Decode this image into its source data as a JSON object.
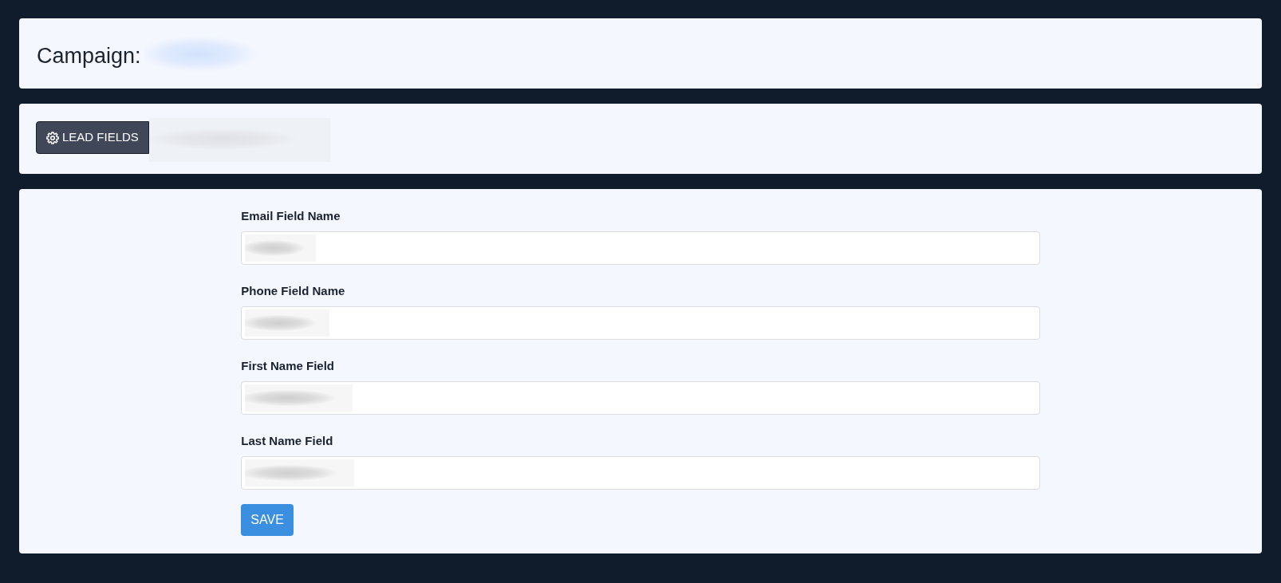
{
  "header": {
    "label": "Campaign:",
    "name_redacted": true
  },
  "tabs": [
    {
      "kind": "labelled",
      "label": "LEAD FIELDS",
      "selected": true
    },
    {
      "kind": "redacted",
      "selected": false
    }
  ],
  "form": {
    "fields": [
      {
        "label": "Email Field Name",
        "value_redacted": true
      },
      {
        "label": "Phone Field Name",
        "value_redacted": true
      },
      {
        "label": "First Name Field",
        "value_redacted": true
      },
      {
        "label": "Last Name Field",
        "value_redacted": true
      }
    ],
    "submit": "SAVE"
  }
}
